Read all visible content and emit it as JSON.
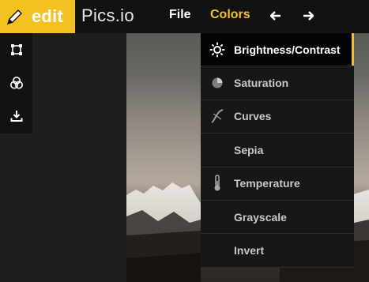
{
  "colors": {
    "accent": "#f3c221",
    "bar": "#121212",
    "menu": "#171717"
  },
  "logo": {
    "label": "edit",
    "icon": "pencil-icon"
  },
  "brand": {
    "name": "Pics.io"
  },
  "menubar": {
    "file_label": "File",
    "colors_label": "Colors",
    "undo_icon": "arrow-left-icon",
    "redo_icon": "arrow-right-icon"
  },
  "tools": [
    {
      "icon": "crop-icon"
    },
    {
      "icon": "color-circles-icon"
    },
    {
      "icon": "download-icon"
    }
  ],
  "colors_menu": {
    "items": [
      {
        "label": "Brightness/Contrast",
        "icon": "sun-icon",
        "active": true
      },
      {
        "label": "Saturation",
        "icon": "saturation-icon"
      },
      {
        "label": "Curves",
        "icon": "curves-icon"
      },
      {
        "label": "Sepia",
        "icon": ""
      },
      {
        "label": "Temperature",
        "icon": "thermometer-icon"
      },
      {
        "label": "Grayscale",
        "icon": ""
      },
      {
        "label": "Invert",
        "icon": ""
      }
    ]
  }
}
